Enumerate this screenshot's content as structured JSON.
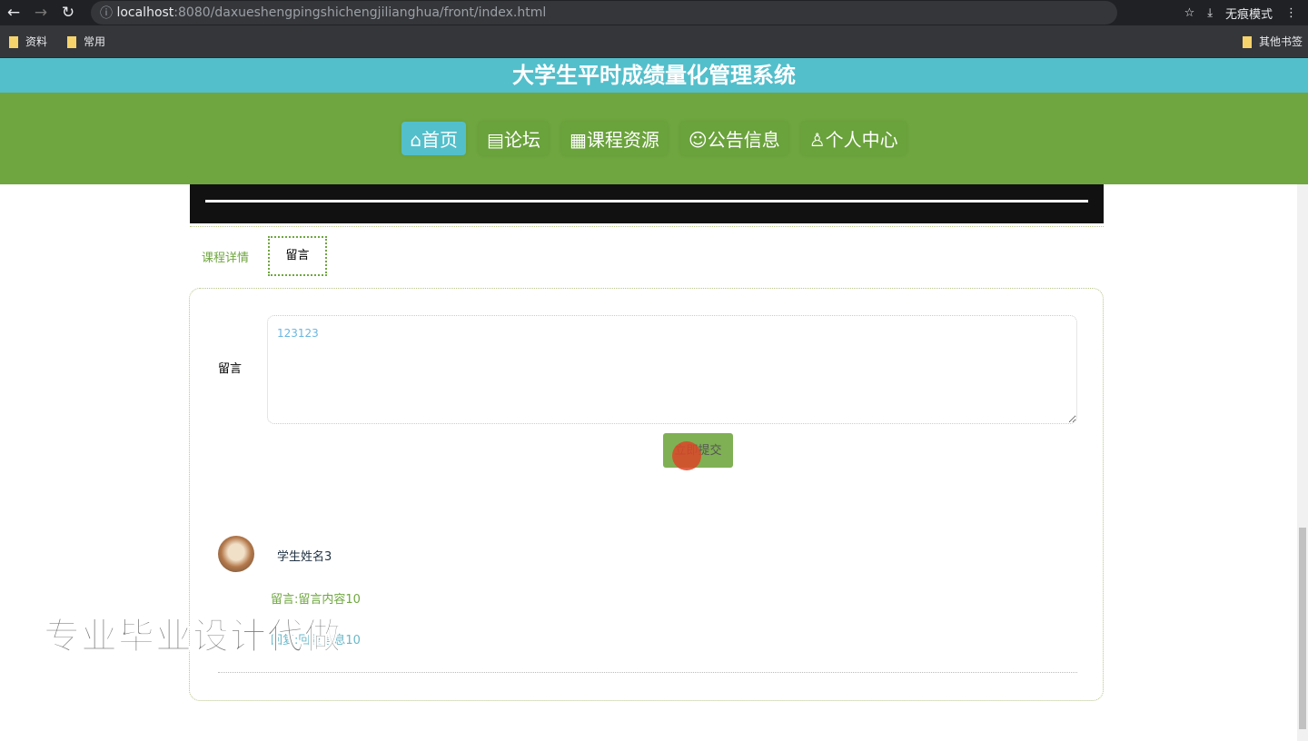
{
  "browser": {
    "url_host": "localhost",
    "url_rest": ":8080/daxueshengpingshichengjilianghua/front/index.html",
    "incognito": "无痕模式",
    "bookmarks": [
      "资料",
      "常用"
    ],
    "other_bookmarks": "其他书签"
  },
  "header": {
    "title": "大学生平时成绩量化管理系统"
  },
  "nav": [
    {
      "icon": "⌂",
      "label": "首页"
    },
    {
      "icon": "▤",
      "label": "论坛"
    },
    {
      "icon": "▦",
      "label": "课程资源"
    },
    {
      "icon": "☺",
      "label": "公告信息"
    },
    {
      "icon": "♙",
      "label": "个人中心"
    }
  ],
  "tabs": {
    "detail": "课程详情",
    "comment": "留言"
  },
  "form": {
    "label": "留言",
    "value": "123123",
    "submit": "立即提交"
  },
  "comments": [
    {
      "name": "学生姓名3",
      "message": "留言:留言内容10",
      "reply": "回复:回复信息10"
    }
  ],
  "watermark": "专业毕业设计代做"
}
